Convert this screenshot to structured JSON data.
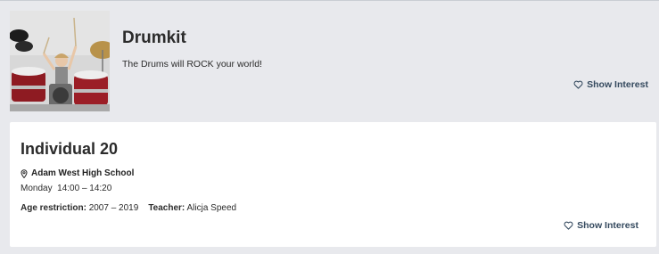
{
  "course": {
    "title": "Drumkit",
    "description": "The Drums will ROCK your world!",
    "interest_label": "Show Interest"
  },
  "session": {
    "title": "Individual 20",
    "location": "Adam West High School",
    "day": "Monday",
    "time": "14:00 – 14:20",
    "age_label": "Age restriction:",
    "age_value": "2007 – 2019",
    "teacher_label": "Teacher:",
    "teacher_value": "Alicja Speed",
    "interest_label": "Show Interest"
  },
  "icons": {
    "heart": "heart-outline-icon",
    "location": "map-pin-icon"
  },
  "colors": {
    "page_bg": "#e8e9ed",
    "card_bg": "#ffffff",
    "interest_text": "#34495e"
  }
}
